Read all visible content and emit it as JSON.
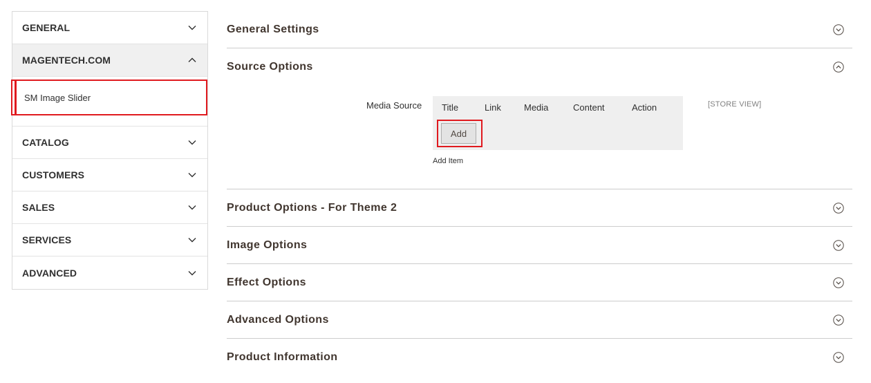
{
  "sidebar": {
    "items": [
      {
        "label": "GENERAL"
      },
      {
        "label": "MAGENTECH.COM"
      },
      {
        "label": "CATALOG"
      },
      {
        "label": "CUSTOMERS"
      },
      {
        "label": "SALES"
      },
      {
        "label": "SERVICES"
      },
      {
        "label": "ADVANCED"
      }
    ],
    "subitem": "SM Image Slider"
  },
  "sections": [
    {
      "title": "General Settings"
    },
    {
      "title": "Source Options"
    },
    {
      "title": "Product Options - For Theme 2"
    },
    {
      "title": "Image Options"
    },
    {
      "title": "Effect Options"
    },
    {
      "title": "Advanced Options"
    },
    {
      "title": "Product Information"
    }
  ],
  "source": {
    "field_label": "Media Source",
    "columns": [
      "Title",
      "Link",
      "Media",
      "Content",
      "Action"
    ],
    "add_button": "Add",
    "add_item": "Add Item",
    "scope": "[STORE VIEW]"
  },
  "colors": {
    "highlight": "#e0191e",
    "divider": "#cccccc",
    "sidebar_open_bg": "#f0f0f0",
    "grid_bg": "#efefef"
  },
  "icons": {
    "chevron_down": "chevron-down-icon",
    "chevron_up": "chevron-up-icon",
    "circle_down": "circle-chevron-down-icon",
    "circle_up": "circle-chevron-up-icon"
  }
}
